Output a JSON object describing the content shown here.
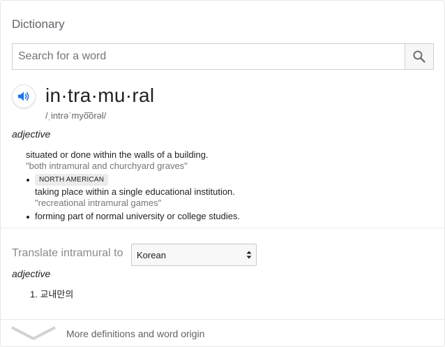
{
  "widget": {
    "title": "Dictionary"
  },
  "search": {
    "placeholder": "Search for a word",
    "value": ""
  },
  "entry": {
    "headword": "in·tra·mu·ral",
    "phonetic": "/ˌintrəˈmyo͞orəl/",
    "part_of_speech": "adjective",
    "senses": [
      {
        "definition": "situated or done within the walls of a building.",
        "example": "\"both intramural and churchyard graves\""
      },
      {
        "tag": "NORTH AMERICAN",
        "definition": "taking place within a single educational institution.",
        "example": "\"recreational intramural games\""
      },
      {
        "definition": "forming part of normal university or college studies."
      }
    ]
  },
  "translate": {
    "label": "Translate intramural to",
    "language": "Korean",
    "part_of_speech": "adjective",
    "items": [
      "1. 교내만의"
    ]
  },
  "footer": {
    "more_label": "More definitions and word origin"
  },
  "colors": {
    "accent_blue": "#1a73e8",
    "muted_text": "#767676",
    "divider": "#ebebeb"
  },
  "icons": {
    "search": "search-icon",
    "speaker": "speaker-icon",
    "expand": "chevron-down-icon",
    "select": "select-arrows-icon"
  }
}
